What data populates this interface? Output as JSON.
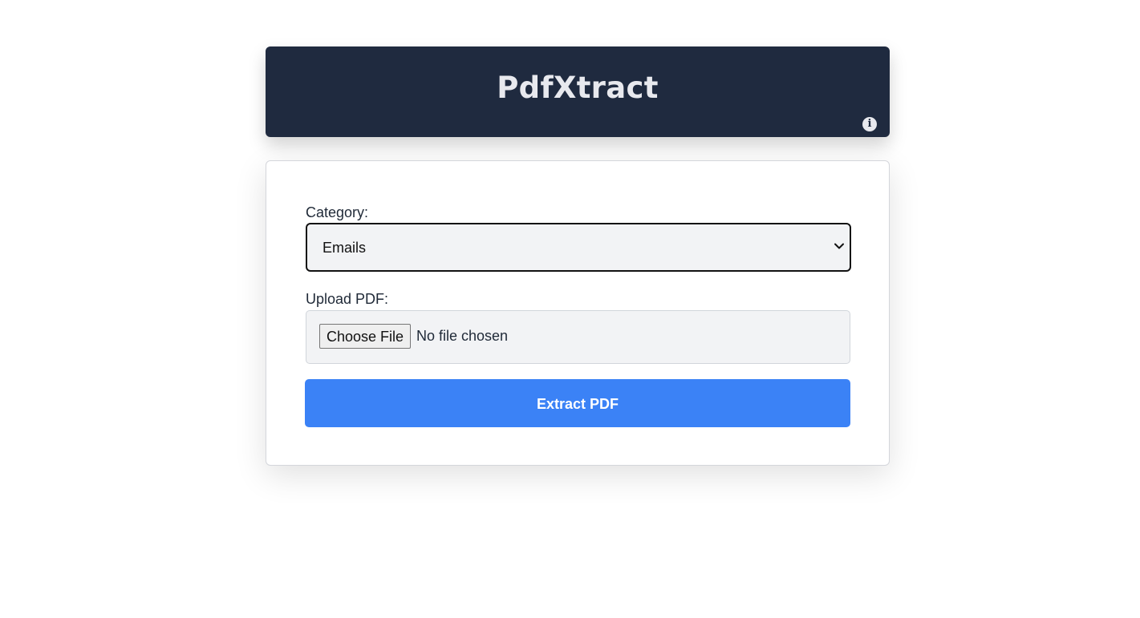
{
  "header": {
    "title": "PdfXtract",
    "info_icon": "info-icon",
    "background_color": "#1f2a3f"
  },
  "form": {
    "category_label": "Category:",
    "category_selected": "Emails",
    "upload_label": "Upload PDF:",
    "choose_file_label": "Choose File",
    "file_status": "No file chosen",
    "submit_label": "Extract PDF",
    "submit_color": "#3b82f6"
  }
}
